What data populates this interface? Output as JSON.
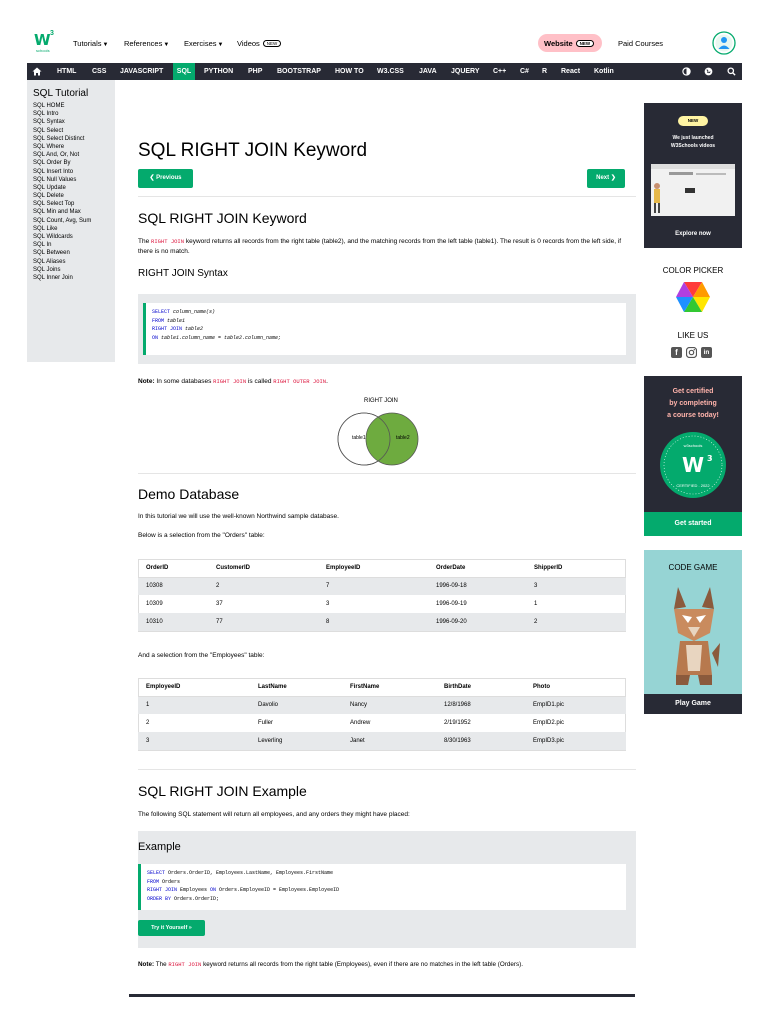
{
  "header": {
    "logo_letter": "W",
    "logo_sup": "3",
    "logo_sub": "schools",
    "menu": [
      {
        "label": "Tutorials"
      },
      {
        "label": "References"
      },
      {
        "label": "Exercises"
      },
      {
        "label": "Videos",
        "badge": "NEW"
      }
    ],
    "website_label": "Website",
    "website_badge": "NEW",
    "paid_courses": "Paid Courses"
  },
  "navbar": {
    "items": [
      "HTML",
      "CSS",
      "JAVASCRIPT",
      "SQL",
      "PYTHON",
      "PHP",
      "BOOTSTRAP",
      "HOW TO",
      "W3.CSS",
      "JAVA",
      "JQUERY",
      "C++",
      "C#",
      "R",
      "React",
      "Kotlin"
    ],
    "active": "SQL",
    "colors": {
      "bar": "#282A35",
      "active": "#04AA6D"
    }
  },
  "sidebar": {
    "title": "SQL Tutorial",
    "items": [
      "SQL HOME",
      "SQL Intro",
      "SQL Syntax",
      "SQL Select",
      "SQL Select Distinct",
      "SQL Where",
      "SQL And, Or, Not",
      "SQL Order By",
      "SQL Insert Into",
      "SQL Null Values",
      "SQL Update",
      "SQL Delete",
      "SQL Select Top",
      "SQL Min and Max",
      "SQL Count, Avg, Sum",
      "SQL Like",
      "SQL Wildcards",
      "SQL In",
      "SQL Between",
      "SQL Aliases",
      "SQL Joins",
      "SQL Inner Join"
    ]
  },
  "main": {
    "title": "SQL RIGHT JOIN Keyword",
    "prev_label": "❮ Previous",
    "next_label": "Next ❯",
    "section1_title": "SQL RIGHT JOIN Keyword",
    "intro_a": "The ",
    "intro_kw": "RIGHT JOIN",
    "intro_b": " keyword returns all records from the right table (table2), and the matching records from the left table (table1). The result is 0 records from the left side, if there is no match.",
    "syntax_title": "RIGHT JOIN Syntax",
    "syntax_code": {
      "l1_kw": "SELECT",
      "l1_rest": " column_name(s)",
      "l2_kw": "FROM",
      "l2_rest": " table1",
      "l3_kw": "RIGHT JOIN",
      "l3_rest": " table2",
      "l4_kw": "ON",
      "l4_rest": " table1.column_name = table2.column_name;"
    },
    "note_label": "Note:",
    "note_a": " In some databases ",
    "note_kw1": "RIGHT JOIN",
    "note_b": " is called ",
    "note_kw2": "RIGHT OUTER JOIN",
    "note_c": ".",
    "venn": {
      "title": "RIGHT JOIN",
      "left": "table1",
      "right": "table2",
      "fill": "#6EAB3F"
    },
    "demo_title": "Demo Database",
    "demo_p1": "In this tutorial we will use the well-known Northwind sample database.",
    "demo_p2": "Below is a selection from the \"Orders\" table:",
    "orders": {
      "headers": [
        "OrderID",
        "CustomerID",
        "EmployeeID",
        "OrderDate",
        "ShipperID"
      ],
      "rows": [
        [
          "10308",
          "2",
          "7",
          "1996-09-18",
          "3"
        ],
        [
          "10309",
          "37",
          "3",
          "1996-09-19",
          "1"
        ],
        [
          "10310",
          "77",
          "8",
          "1996-09-20",
          "2"
        ]
      ]
    },
    "demo_p3": "And a selection from the \"Employees\" table:",
    "employees": {
      "headers": [
        "EmployeeID",
        "LastName",
        "FirstName",
        "BirthDate",
        "Photo"
      ],
      "rows": [
        [
          "1",
          "Davolio",
          "Nancy",
          "12/8/1968",
          "EmpID1.pic"
        ],
        [
          "2",
          "Fuller",
          "Andrew",
          "2/19/1952",
          "EmpID2.pic"
        ],
        [
          "3",
          "Leverling",
          "Janet",
          "8/30/1963",
          "EmpID3.pic"
        ]
      ]
    },
    "example_section_title": "SQL RIGHT JOIN Example",
    "example_intro": "The following SQL statement will return all employees, and any orders they might have placed:",
    "example_box_title": "Example",
    "example_code": {
      "l1_kw": "SELECT",
      "l1_rest": " Orders.OrderID, Employees.LastName, Employees.FirstName",
      "l2_kw": "FROM",
      "l2_rest": " Orders",
      "l3_kw": "RIGHT JOIN",
      "l3_mid": " Employees ",
      "l3_kw2": "ON",
      "l3_rest": " Orders.EmployeeID = Employees.EmployeeID",
      "l4_kw": "ORDER BY",
      "l4_rest": " Orders.OrderID;"
    },
    "try_label": "Try it Yourself »",
    "bottom_note_label": "Note:",
    "bottom_note_a": " The ",
    "bottom_note_kw": "RIGHT JOIN",
    "bottom_note_b": " keyword returns all records from the right table (Employees), even if there are no matches in the left table (Orders)."
  },
  "right": {
    "promo_badge": "NEW",
    "promo_text1": "We just launched",
    "promo_text2": "W3Schools videos",
    "promo_link": "Explore now",
    "color_picker": "COLOR PICKER",
    "like_us": "LIKE US",
    "cert_text1": "Get certified",
    "cert_text2": "by completing",
    "cert_text3": "a course today!",
    "cert_badge_top": "w3schools",
    "cert_badge_bottom": "CERTIFIED . 2022",
    "cert_button": "Get started",
    "code_game": "CODE GAME",
    "play_game": "Play Game",
    "colors": {
      "dark": "#282A35",
      "brand": "#04AA6D",
      "yellow": "#FFF4A3",
      "teal": "#96D4D4"
    }
  }
}
